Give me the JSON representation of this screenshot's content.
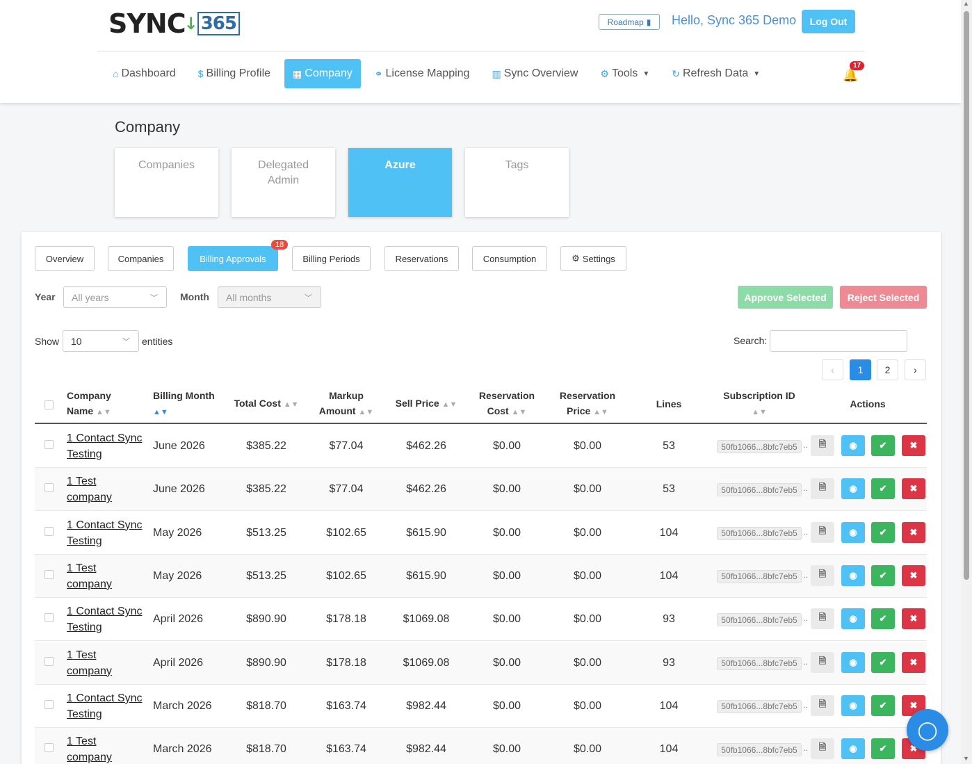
{
  "header": {
    "logo_text": "SYNC",
    "logo_num": "365",
    "roadmap_label": "Roadmap",
    "greeting": "Hello, Sync 365 Demo",
    "logout_label": "Log Out",
    "notification_count": "17"
  },
  "nav": [
    {
      "label": "Dashboard",
      "icon": "home-icon",
      "glyph": "⌂"
    },
    {
      "label": "Billing Profile",
      "icon": "dollar-icon",
      "glyph": "$"
    },
    {
      "label": "Company",
      "icon": "building-icon",
      "glyph": "▦",
      "active": true
    },
    {
      "label": "License Mapping",
      "icon": "link-icon",
      "glyph": "⚭"
    },
    {
      "label": "Sync Overview",
      "icon": "bar-chart-icon",
      "glyph": "▥"
    },
    {
      "label": "Tools",
      "icon": "gears-icon",
      "glyph": "⚙",
      "dropdown": true
    },
    {
      "label": "Refresh Data",
      "icon": "refresh-icon",
      "glyph": "↻",
      "dropdown": true
    }
  ],
  "page_title": "Company",
  "cards": [
    {
      "label": "Companies"
    },
    {
      "label": "Delegated Admin"
    },
    {
      "label": "Azure",
      "active": true
    },
    {
      "label": "Tags"
    }
  ],
  "tabs": [
    {
      "label": "Overview"
    },
    {
      "label": "Companies"
    },
    {
      "label": "Billing Approvals",
      "active": true,
      "badge": "18"
    },
    {
      "label": "Billing Periods"
    },
    {
      "label": "Reservations"
    },
    {
      "label": "Consumption"
    },
    {
      "label": "Settings",
      "icon": "gear-icon"
    }
  ],
  "filters": {
    "year_label": "Year",
    "year_value": "All years",
    "month_label": "Month",
    "month_value": "All months",
    "approve_label": "Approve Selected",
    "reject_label": "Reject Selected"
  },
  "table_controls": {
    "show_label": "Show",
    "page_size": "10",
    "entities_label": "entities",
    "search_label": "Search:"
  },
  "pagination": {
    "prev": "‹",
    "pages": [
      "1",
      "2"
    ],
    "current": "1",
    "next": "›"
  },
  "columns": [
    {
      "key": "company",
      "label": "Company Name"
    },
    {
      "key": "month",
      "label": "Billing Month"
    },
    {
      "key": "total",
      "label": "Total Cost"
    },
    {
      "key": "markup",
      "label": "Markup Amount"
    },
    {
      "key": "sell",
      "label": "Sell Price"
    },
    {
      "key": "rescost",
      "label": "Reservation Cost"
    },
    {
      "key": "resprice",
      "label": "Reservation Price"
    },
    {
      "key": "lines",
      "label": "Lines"
    },
    {
      "key": "sub",
      "label": "Subscription ID"
    },
    {
      "key": "actions",
      "label": "Actions"
    }
  ],
  "rows": [
    {
      "company": "1 Contact Sync Testing",
      "month": "June 2026",
      "total": "$385.22",
      "markup": "$77.04",
      "sell": "$462.26",
      "rescost": "$0.00",
      "resprice": "$0.00",
      "lines": "53",
      "sub": "50fb1066...8bfc7eb5"
    },
    {
      "company": "1 Test company",
      "month": "June 2026",
      "total": "$385.22",
      "markup": "$77.04",
      "sell": "$462.26",
      "rescost": "$0.00",
      "resprice": "$0.00",
      "lines": "53",
      "sub": "50fb1066...8bfc7eb5"
    },
    {
      "company": "1 Contact Sync Testing",
      "month": "May 2026",
      "total": "$513.25",
      "markup": "$102.65",
      "sell": "$615.90",
      "rescost": "$0.00",
      "resprice": "$0.00",
      "lines": "104",
      "sub": "50fb1066...8bfc7eb5"
    },
    {
      "company": "1 Test company",
      "month": "May 2026",
      "total": "$513.25",
      "markup": "$102.65",
      "sell": "$615.90",
      "rescost": "$0.00",
      "resprice": "$0.00",
      "lines": "104",
      "sub": "50fb1066...8bfc7eb5"
    },
    {
      "company": "1 Contact Sync Testing",
      "month": "April 2026",
      "total": "$890.90",
      "markup": "$178.18",
      "sell": "$1069.08",
      "rescost": "$0.00",
      "resprice": "$0.00",
      "lines": "93",
      "sub": "50fb1066...8bfc7eb5"
    },
    {
      "company": "1 Test company",
      "month": "April 2026",
      "total": "$890.90",
      "markup": "$178.18",
      "sell": "$1069.08",
      "rescost": "$0.00",
      "resprice": "$0.00",
      "lines": "93",
      "sub": "50fb1066...8bfc7eb5"
    },
    {
      "company": "1 Contact Sync Testing",
      "month": "March 2026",
      "total": "$818.70",
      "markup": "$163.74",
      "sell": "$982.44",
      "rescost": "$0.00",
      "resprice": "$0.00",
      "lines": "104",
      "sub": "50fb1066...8bfc7eb5"
    },
    {
      "company": "1 Test company",
      "month": "March 2026",
      "total": "$818.70",
      "markup": "$163.74",
      "sell": "$982.44",
      "rescost": "$0.00",
      "resprice": "$0.00",
      "lines": "104",
      "sub": "50fb1066...8bfc7eb5"
    }
  ],
  "colors": {
    "accent": "#4fc1f5",
    "primary": "#2b8ce6",
    "success": "#3cb55f",
    "danger": "#dc3545"
  }
}
